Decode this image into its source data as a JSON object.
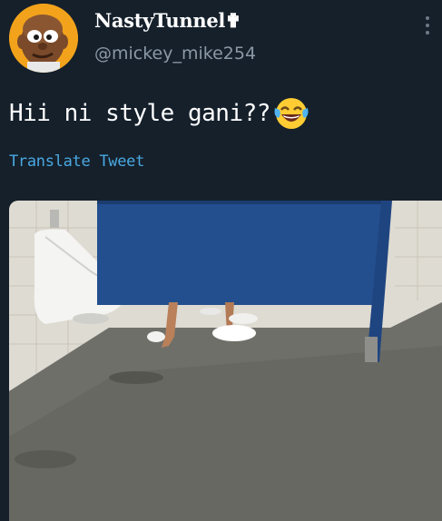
{
  "user": {
    "display_name": "NastyTunnel✟",
    "handle": "@mickey_mike254",
    "avatar_icon": "cartoon-face-avatar"
  },
  "tweet": {
    "text": "Hii ni style gani??",
    "emoji_icon": "face-with-tears-of-joy-icon",
    "translate_label": "Translate Tweet"
  },
  "media": {
    "image_icon": "bathroom-stall-photo"
  },
  "colors": {
    "background": "#15202b",
    "text": "#ffffff",
    "secondary_text": "#8b98a5",
    "link": "#4aa8e0"
  }
}
